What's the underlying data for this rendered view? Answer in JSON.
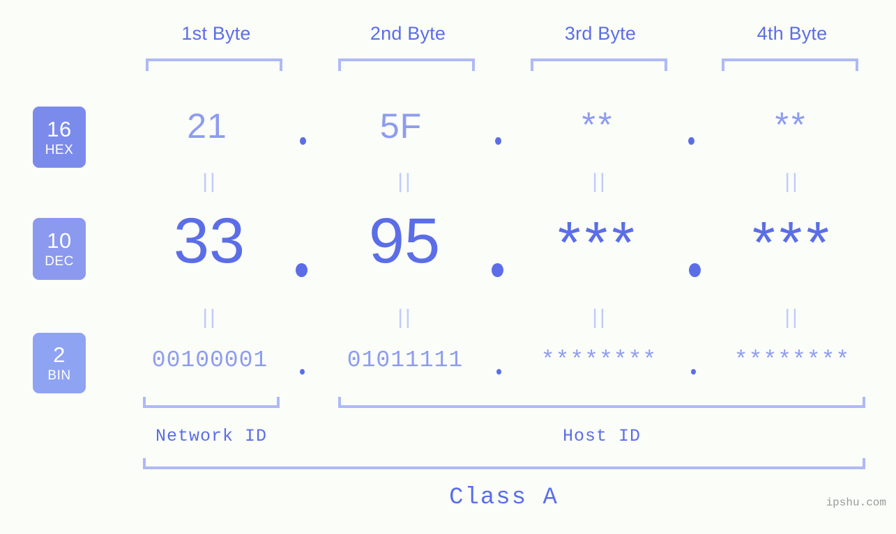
{
  "meta": {
    "background": "#fbfdf8",
    "accent": "#5b6ee8",
    "accent_light": "#8d9cf0",
    "bracket": "#aeb9f7",
    "watermark": "ipshu.com"
  },
  "headers": [
    {
      "label": "1st Byte"
    },
    {
      "label": "2nd Byte"
    },
    {
      "label": "3rd Byte"
    },
    {
      "label": "4th Byte"
    }
  ],
  "bases": [
    {
      "id": "hex",
      "number": "16",
      "name": "HEX",
      "color": "#7b8bec"
    },
    {
      "id": "dec",
      "number": "10",
      "name": "DEC",
      "color": "#8b99ee"
    },
    {
      "id": "bin",
      "number": "2",
      "name": "BIN",
      "color": "#8fa3f3"
    }
  ],
  "rows": {
    "hex": {
      "values": [
        "21",
        "5F",
        "**",
        "**"
      ]
    },
    "dec": {
      "values": [
        "33",
        "95",
        "***",
        "***"
      ]
    },
    "bin": {
      "values": [
        "00100001",
        "01011111",
        "********",
        "********"
      ]
    }
  },
  "separators": {
    "dot": ".",
    "equals": "||"
  },
  "segments": [
    {
      "id": "network",
      "label": "Network ID"
    },
    {
      "id": "host",
      "label": "Host ID"
    }
  ],
  "class": {
    "label": "Class A"
  }
}
